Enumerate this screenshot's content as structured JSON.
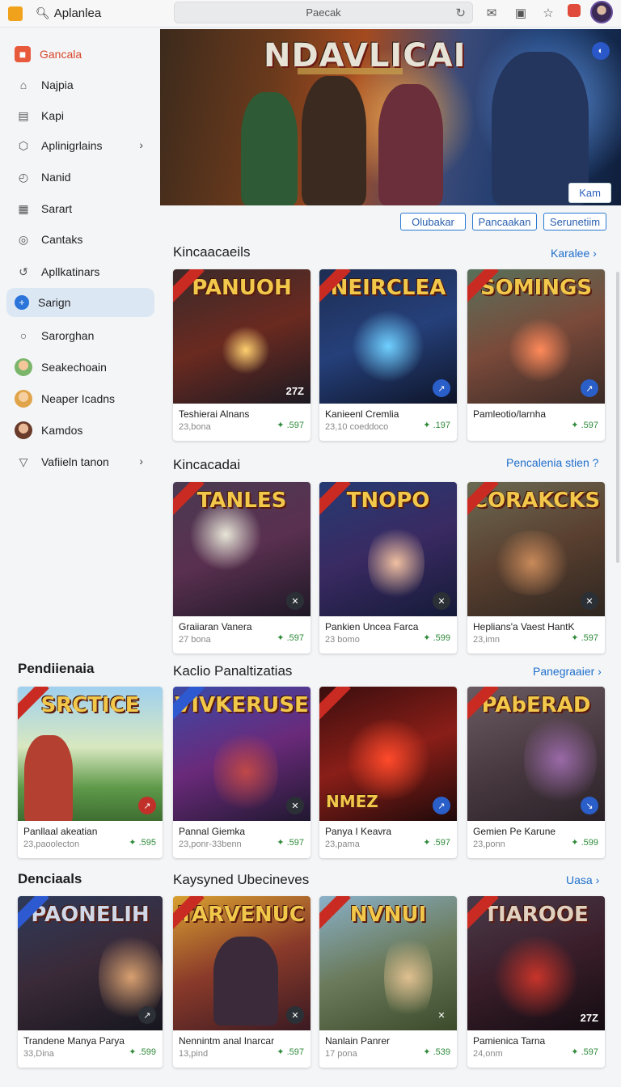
{
  "topbar": {
    "title": "Aplanlea",
    "address": "Paecak"
  },
  "sidebar": {
    "items": [
      {
        "label": "Gancala"
      },
      {
        "label": "Najpia"
      },
      {
        "label": "Kapi"
      },
      {
        "label": "Aplinigrlains"
      },
      {
        "label": "Nanid"
      },
      {
        "label": "Sarart"
      },
      {
        "label": "Cantaks"
      },
      {
        "label": "Apllkatinars"
      },
      {
        "label": "Sarign"
      },
      {
        "label": "Sarorghan"
      },
      {
        "label": "Seakechoain"
      },
      {
        "label": "Neaper Icadns"
      },
      {
        "label": "Kamdos"
      },
      {
        "label": "Vafiieln tanon"
      }
    ]
  },
  "hero": {
    "title": "NDAVLICAI",
    "button": "Kam"
  },
  "chips": [
    "Olubakar",
    "Pancaakan",
    "Serunetiim"
  ],
  "sections": {
    "s1": {
      "title": "Kincaacaeils",
      "link": "Karalee"
    },
    "s2": {
      "title": "Kincacadai",
      "link": "Pencalenia stien"
    },
    "s3left": {
      "title": "Pendiienaia"
    },
    "s3": {
      "title": "Kaclio Panaltizatias",
      "link": "Panegraaier"
    },
    "s4left": {
      "title": "Denciaals"
    },
    "s4": {
      "title": "Kaysyned Ubecineves",
      "link": "Uasa"
    }
  },
  "cards": {
    "r1": [
      {
        "logo": "PANUOH",
        "name": "Teshierai Alnans",
        "meta": "23,bona",
        "price": "597",
        "corner": "27Z"
      },
      {
        "logo": "NEIRCLEA",
        "name": "Kanieenl Cremlia",
        "meta": "23,10 coeddoco",
        "price": "197"
      },
      {
        "logo": "SOMINGS",
        "name": "Pamleotio/larnha",
        "meta": "",
        "price": "597"
      }
    ],
    "r2": [
      {
        "logo": "TANLES",
        "name": "Graiiaran Vanera",
        "meta": "27 bona",
        "price": "597"
      },
      {
        "logo": "TNOPO",
        "name": "Pankien Uncea Farca",
        "meta": "23 bomo",
        "price": "599"
      },
      {
        "logo": "CORAKCKS",
        "name": "Heplians'a Vaest HantK",
        "meta": "23,imn",
        "price": "597"
      }
    ],
    "r3": [
      {
        "logo": "SRCTICE",
        "name": "Panllaal akeatian",
        "meta": "23,paoolecton",
        "price": "595"
      },
      {
        "logo": "VIVKERUSE",
        "name": "Pannal Giemka",
        "meta": "23,ponr-33benn",
        "price": "597"
      },
      {
        "logo": "NMEZ",
        "name": "Panya I Keavra",
        "meta": "23,pama",
        "price": "597"
      },
      {
        "logo": "PAbERAD",
        "name": "Gemien Pe Karune",
        "meta": "23,ponn",
        "price": "599"
      }
    ],
    "r4": [
      {
        "logo": "PAONELIH",
        "name": "Trandene Manya Parya",
        "meta": "33,Dina",
        "price": "599"
      },
      {
        "logo": "TARVENUC",
        "name": "Nennintm anal Inarcar",
        "meta": "13,pind",
        "price": "597"
      },
      {
        "logo": "NVNUI",
        "name": "Nanlain Panrer",
        "meta": "17 pona",
        "price": "539"
      },
      {
        "logo": "TIAROOE",
        "name": "Pamienica Tarna",
        "meta": "24,onm",
        "price": "597",
        "corner": "27Z"
      }
    ]
  }
}
